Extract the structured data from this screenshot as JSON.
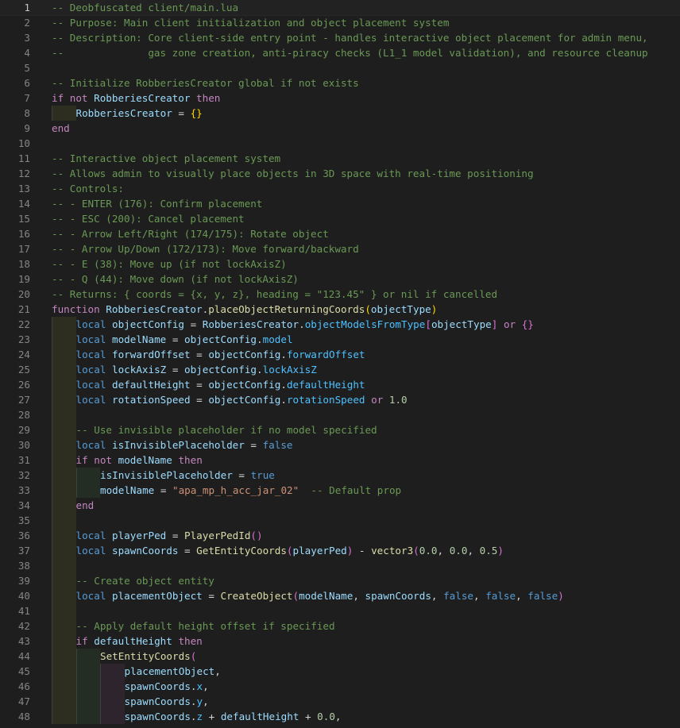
{
  "editor": {
    "file_header": "-- Deobfuscated client/main.lua",
    "current_line": 1,
    "lines": [
      {
        "n": "1",
        "indent": 0,
        "tokens": [
          [
            "c",
            "-- Deobfuscated client/main.lua"
          ]
        ]
      },
      {
        "n": "2",
        "indent": 0,
        "tokens": [
          [
            "c",
            "-- Purpose: Main client initialization and object placement system"
          ]
        ]
      },
      {
        "n": "3",
        "indent": 0,
        "tokens": [
          [
            "c",
            "-- Description: Core client-side entry point - handles interactive object placement for admin menu,"
          ]
        ]
      },
      {
        "n": "4",
        "indent": 0,
        "tokens": [
          [
            "c",
            "--              gas zone creation, anti-piracy checks (L1_1 model validation), and resource cleanup"
          ]
        ]
      },
      {
        "n": "5",
        "indent": 0,
        "tokens": []
      },
      {
        "n": "6",
        "indent": 0,
        "tokens": [
          [
            "c",
            "-- Initialize RobberiesCreator global if not exists"
          ]
        ]
      },
      {
        "n": "7",
        "indent": 0,
        "tokens": [
          [
            "k",
            "if"
          ],
          [
            "t",
            " "
          ],
          [
            "k",
            "not"
          ],
          [
            "t",
            " "
          ],
          [
            "v",
            "RobberiesCreator"
          ],
          [
            "t",
            " "
          ],
          [
            "k",
            "then"
          ]
        ]
      },
      {
        "n": "8",
        "indent": 1,
        "tokens": [
          [
            "v",
            "RobberiesCreator"
          ],
          [
            "t",
            " = "
          ],
          [
            "b1",
            "{}"
          ]
        ]
      },
      {
        "n": "9",
        "indent": 0,
        "tokens": [
          [
            "k",
            "end"
          ]
        ]
      },
      {
        "n": "10",
        "indent": 0,
        "tokens": []
      },
      {
        "n": "11",
        "indent": 0,
        "tokens": [
          [
            "c",
            "-- Interactive object placement system"
          ]
        ]
      },
      {
        "n": "12",
        "indent": 0,
        "tokens": [
          [
            "c",
            "-- Allows admin to visually place objects in 3D space with real-time positioning"
          ]
        ]
      },
      {
        "n": "13",
        "indent": 0,
        "tokens": [
          [
            "c",
            "-- Controls:"
          ]
        ]
      },
      {
        "n": "14",
        "indent": 0,
        "tokens": [
          [
            "c",
            "-- - ENTER (176): Confirm placement"
          ]
        ]
      },
      {
        "n": "15",
        "indent": 0,
        "tokens": [
          [
            "c",
            "-- - ESC (200): Cancel placement"
          ]
        ]
      },
      {
        "n": "16",
        "indent": 0,
        "tokens": [
          [
            "c",
            "-- - Arrow Left/Right (174/175): Rotate object"
          ]
        ]
      },
      {
        "n": "17",
        "indent": 0,
        "tokens": [
          [
            "c",
            "-- - Arrow Up/Down (172/173): Move forward/backward"
          ]
        ]
      },
      {
        "n": "18",
        "indent": 0,
        "tokens": [
          [
            "c",
            "-- - E (38): Move up (if not lockAxisZ)"
          ]
        ]
      },
      {
        "n": "19",
        "indent": 0,
        "tokens": [
          [
            "c",
            "-- - Q (44): Move down (if not lockAxisZ)"
          ]
        ]
      },
      {
        "n": "20",
        "indent": 0,
        "tokens": [
          [
            "c",
            "-- Returns: { coords = {x, y, z}, heading = \"123.45\" } or nil if cancelled"
          ]
        ]
      },
      {
        "n": "21",
        "indent": 0,
        "tokens": [
          [
            "k",
            "function"
          ],
          [
            "t",
            " "
          ],
          [
            "v",
            "RobberiesCreator"
          ],
          [
            "t",
            "."
          ],
          [
            "f",
            "placeObjectReturningCoords"
          ],
          [
            "b1",
            "("
          ],
          [
            "v",
            "objectType"
          ],
          [
            "b1",
            ")"
          ]
        ]
      },
      {
        "n": "22",
        "indent": 1,
        "tokens": [
          [
            "kb",
            "local"
          ],
          [
            "t",
            " "
          ],
          [
            "v",
            "objectConfig"
          ],
          [
            "t",
            " = "
          ],
          [
            "v",
            "RobberiesCreator"
          ],
          [
            "t",
            "."
          ],
          [
            "p",
            "objectModelsFromType"
          ],
          [
            "b2",
            "["
          ],
          [
            "v",
            "objectType"
          ],
          [
            "b2",
            "]"
          ],
          [
            "t",
            " "
          ],
          [
            "k",
            "or"
          ],
          [
            "t",
            " "
          ],
          [
            "b2",
            "{}"
          ]
        ]
      },
      {
        "n": "23",
        "indent": 1,
        "tokens": [
          [
            "kb",
            "local"
          ],
          [
            "t",
            " "
          ],
          [
            "v",
            "modelName"
          ],
          [
            "t",
            " = "
          ],
          [
            "v",
            "objectConfig"
          ],
          [
            "t",
            "."
          ],
          [
            "p",
            "model"
          ]
        ]
      },
      {
        "n": "24",
        "indent": 1,
        "tokens": [
          [
            "kb",
            "local"
          ],
          [
            "t",
            " "
          ],
          [
            "v",
            "forwardOffset"
          ],
          [
            "t",
            " = "
          ],
          [
            "v",
            "objectConfig"
          ],
          [
            "t",
            "."
          ],
          [
            "p",
            "forwardOffset"
          ]
        ]
      },
      {
        "n": "25",
        "indent": 1,
        "tokens": [
          [
            "kb",
            "local"
          ],
          [
            "t",
            " "
          ],
          [
            "v",
            "lockAxisZ"
          ],
          [
            "t",
            " = "
          ],
          [
            "v",
            "objectConfig"
          ],
          [
            "t",
            "."
          ],
          [
            "p",
            "lockAxisZ"
          ]
        ]
      },
      {
        "n": "26",
        "indent": 1,
        "tokens": [
          [
            "kb",
            "local"
          ],
          [
            "t",
            " "
          ],
          [
            "v",
            "defaultHeight"
          ],
          [
            "t",
            " = "
          ],
          [
            "v",
            "objectConfig"
          ],
          [
            "t",
            "."
          ],
          [
            "p",
            "defaultHeight"
          ]
        ]
      },
      {
        "n": "27",
        "indent": 1,
        "tokens": [
          [
            "kb",
            "local"
          ],
          [
            "t",
            " "
          ],
          [
            "v",
            "rotationSpeed"
          ],
          [
            "t",
            " = "
          ],
          [
            "v",
            "objectConfig"
          ],
          [
            "t",
            "."
          ],
          [
            "p",
            "rotationSpeed"
          ],
          [
            "t",
            " "
          ],
          [
            "k",
            "or"
          ],
          [
            "t",
            " "
          ],
          [
            "n",
            "1.0"
          ]
        ]
      },
      {
        "n": "28",
        "indent": 1,
        "tokens": []
      },
      {
        "n": "29",
        "indent": 1,
        "tokens": [
          [
            "c",
            "-- Use invisible placeholder if no model specified"
          ]
        ]
      },
      {
        "n": "30",
        "indent": 1,
        "tokens": [
          [
            "kb",
            "local"
          ],
          [
            "t",
            " "
          ],
          [
            "v",
            "isInvisiblePlaceholder"
          ],
          [
            "t",
            " = "
          ],
          [
            "kb",
            "false"
          ]
        ]
      },
      {
        "n": "31",
        "indent": 1,
        "tokens": [
          [
            "k",
            "if"
          ],
          [
            "t",
            " "
          ],
          [
            "k",
            "not"
          ],
          [
            "t",
            " "
          ],
          [
            "v",
            "modelName"
          ],
          [
            "t",
            " "
          ],
          [
            "k",
            "then"
          ]
        ]
      },
      {
        "n": "32",
        "indent": 2,
        "tokens": [
          [
            "v",
            "isInvisiblePlaceholder"
          ],
          [
            "t",
            " = "
          ],
          [
            "kb",
            "true"
          ]
        ]
      },
      {
        "n": "33",
        "indent": 2,
        "tokens": [
          [
            "v",
            "modelName"
          ],
          [
            "t",
            " = "
          ],
          [
            "s",
            "\"apa_mp_h_acc_jar_02\""
          ],
          [
            "t",
            "  "
          ],
          [
            "c",
            "-- Default prop"
          ]
        ]
      },
      {
        "n": "34",
        "indent": 1,
        "tokens": [
          [
            "k",
            "end"
          ]
        ]
      },
      {
        "n": "35",
        "indent": 1,
        "tokens": []
      },
      {
        "n": "36",
        "indent": 1,
        "tokens": [
          [
            "kb",
            "local"
          ],
          [
            "t",
            " "
          ],
          [
            "v",
            "playerPed"
          ],
          [
            "t",
            " = "
          ],
          [
            "f",
            "PlayerPedId"
          ],
          [
            "b2",
            "()"
          ]
        ]
      },
      {
        "n": "37",
        "indent": 1,
        "tokens": [
          [
            "kb",
            "local"
          ],
          [
            "t",
            " "
          ],
          [
            "v",
            "spawnCoords"
          ],
          [
            "t",
            " = "
          ],
          [
            "f",
            "GetEntityCoords"
          ],
          [
            "b2",
            "("
          ],
          [
            "v",
            "playerPed"
          ],
          [
            "b2",
            ")"
          ],
          [
            "t",
            " - "
          ],
          [
            "f",
            "vector3"
          ],
          [
            "b2",
            "("
          ],
          [
            "n",
            "0.0"
          ],
          [
            "t",
            ", "
          ],
          [
            "n",
            "0.0"
          ],
          [
            "t",
            ", "
          ],
          [
            "n",
            "0.5"
          ],
          [
            "b2",
            ")"
          ]
        ]
      },
      {
        "n": "38",
        "indent": 1,
        "tokens": []
      },
      {
        "n": "39",
        "indent": 1,
        "tokens": [
          [
            "c",
            "-- Create object entity"
          ]
        ]
      },
      {
        "n": "40",
        "indent": 1,
        "tokens": [
          [
            "kb",
            "local"
          ],
          [
            "t",
            " "
          ],
          [
            "v",
            "placementObject"
          ],
          [
            "t",
            " = "
          ],
          [
            "f",
            "CreateObject"
          ],
          [
            "b2",
            "("
          ],
          [
            "v",
            "modelName"
          ],
          [
            "t",
            ", "
          ],
          [
            "v",
            "spawnCoords"
          ],
          [
            "t",
            ", "
          ],
          [
            "kb",
            "false"
          ],
          [
            "t",
            ", "
          ],
          [
            "kb",
            "false"
          ],
          [
            "t",
            ", "
          ],
          [
            "kb",
            "false"
          ],
          [
            "b2",
            ")"
          ]
        ]
      },
      {
        "n": "41",
        "indent": 1,
        "tokens": []
      },
      {
        "n": "42",
        "indent": 1,
        "tokens": [
          [
            "c",
            "-- Apply default height offset if specified"
          ]
        ]
      },
      {
        "n": "43",
        "indent": 1,
        "tokens": [
          [
            "k",
            "if"
          ],
          [
            "t",
            " "
          ],
          [
            "v",
            "defaultHeight"
          ],
          [
            "t",
            " "
          ],
          [
            "k",
            "then"
          ]
        ]
      },
      {
        "n": "44",
        "indent": 2,
        "tokens": [
          [
            "f",
            "SetEntityCoords"
          ],
          [
            "b2",
            "("
          ]
        ]
      },
      {
        "n": "45",
        "indent": 3,
        "tokens": [
          [
            "v",
            "placementObject"
          ],
          [
            "t",
            ","
          ]
        ]
      },
      {
        "n": "46",
        "indent": 3,
        "tokens": [
          [
            "v",
            "spawnCoords"
          ],
          [
            "t",
            "."
          ],
          [
            "p",
            "x"
          ],
          [
            "t",
            ","
          ]
        ]
      },
      {
        "n": "47",
        "indent": 3,
        "tokens": [
          [
            "v",
            "spawnCoords"
          ],
          [
            "t",
            "."
          ],
          [
            "p",
            "y"
          ],
          [
            "t",
            ","
          ]
        ]
      },
      {
        "n": "48",
        "indent": 3,
        "tokens": [
          [
            "v",
            "spawnCoords"
          ],
          [
            "t",
            "."
          ],
          [
            "p",
            "z"
          ],
          [
            "t",
            " + "
          ],
          [
            "v",
            "defaultHeight"
          ],
          [
            "t",
            " + "
          ],
          [
            "n",
            "0.0"
          ],
          [
            "t",
            ","
          ]
        ]
      }
    ]
  }
}
